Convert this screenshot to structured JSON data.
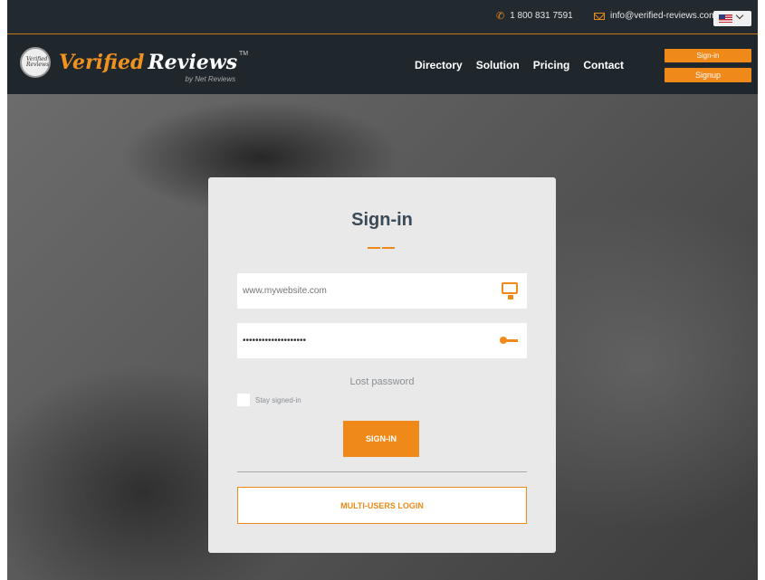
{
  "topbar": {
    "phone": "1 800 831 7591",
    "email": "info@verified-reviews.com",
    "language_flag": "us-flag-icon"
  },
  "header": {
    "brand_part1": "Verified",
    "brand_part2": "Reviews",
    "trademark": "TM",
    "byline": "by Net Reviews",
    "seal_text": "Verified Reviews",
    "nav": [
      "Directory",
      "Solution",
      "Pricing",
      "Contact"
    ],
    "signin_label": "Sign-in",
    "signup_label": "Signup"
  },
  "login": {
    "title": "Sign-in",
    "website_placeholder": "www.mywebsite.com",
    "password_value": "••••••••••••••••••••",
    "lost_password": "Lost password",
    "stay_signed_in": "Stay signed-in",
    "signin_button": "SIGN-IN",
    "multi_users_button": "MULTI-USERS LOGIN"
  },
  "colors": {
    "accent": "#ef8a1a",
    "header_bg": "#1f272c",
    "card_bg": "#e9e9e9"
  }
}
